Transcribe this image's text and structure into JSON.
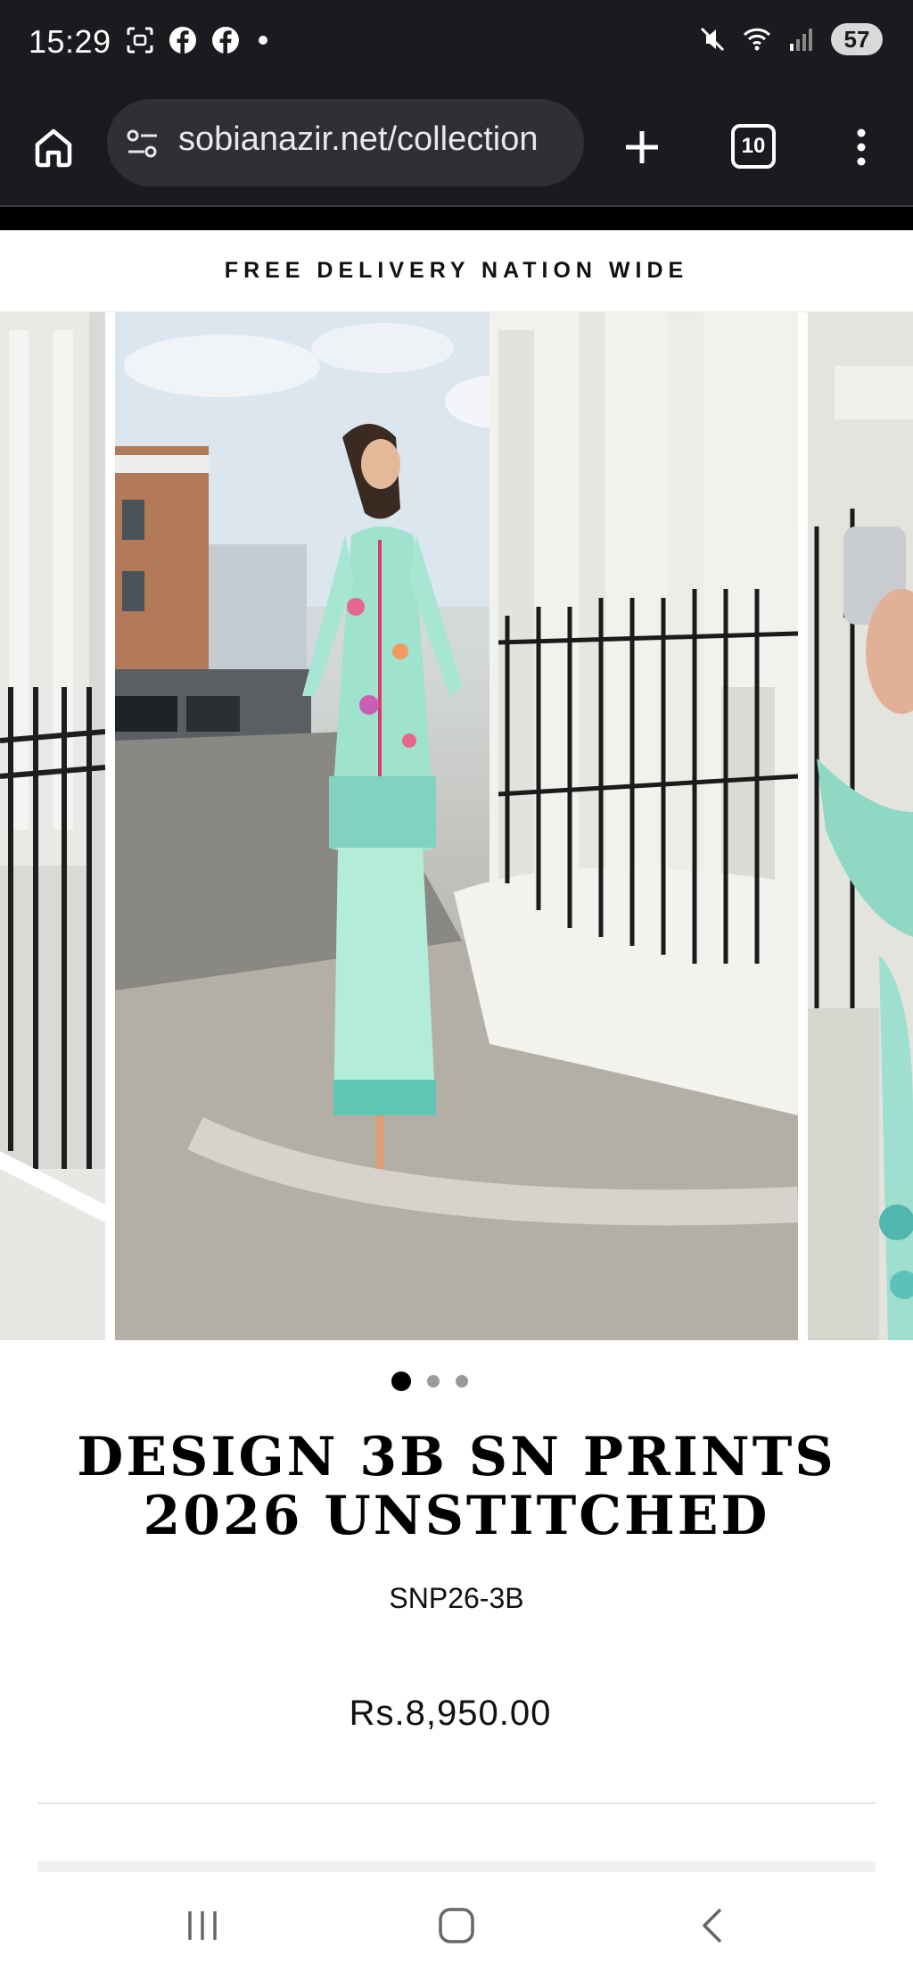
{
  "status_bar": {
    "time": "15:29",
    "left_icons": [
      "screenshot-icon",
      "facebook-icon",
      "facebook-icon",
      "notification-dot"
    ],
    "right_icons": [
      "mute-icon",
      "wifi-icon",
      "signal-icon"
    ],
    "battery": "57"
  },
  "browser": {
    "url": "sobianazir.net/collection",
    "tab_count": "10",
    "buttons": [
      "home-icon",
      "site-settings-icon",
      "new-tab-icon",
      "tab-switcher",
      "menu-icon"
    ]
  },
  "announcement": {
    "text": "FREE DELIVERY NATION WIDE"
  },
  "gallery": {
    "slide_count": 3,
    "active_index": 0
  },
  "product": {
    "title": "DESIGN 3B SN PRINTS 2026 UNSTITCHED",
    "sku": "SNP26-3B",
    "price": "Rs.8,950.00"
  },
  "colors": {
    "system_bar": "#1b1b1f",
    "url_pill": "#2e3036",
    "text": "#111111",
    "dot_active": "#000000",
    "dot_inactive": "#9a9a9a"
  }
}
